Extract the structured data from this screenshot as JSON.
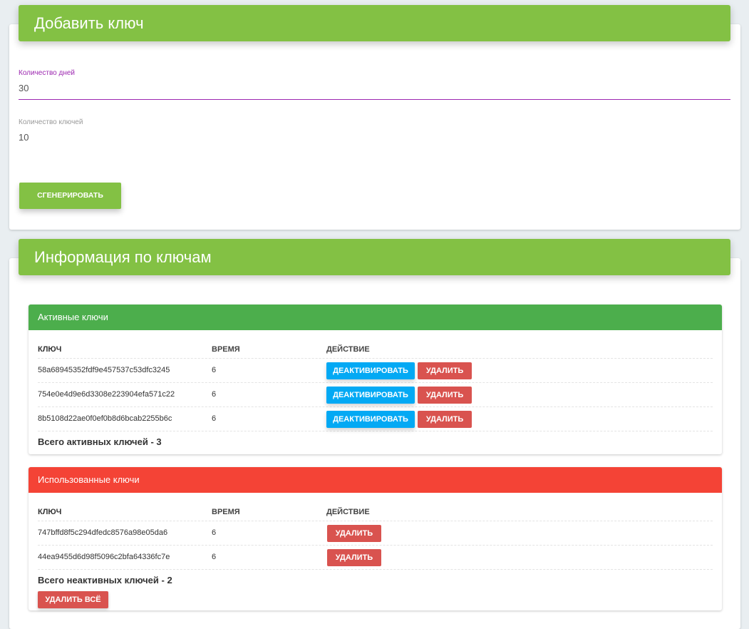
{
  "add_key": {
    "title": "Добавить ключ",
    "days_label": "Количество дней",
    "days_value": "30",
    "keys_label": "Количество ключей",
    "keys_value": "10",
    "generate_button": "Сгенерировать"
  },
  "info": {
    "title": "Информация по ключам",
    "columns": {
      "key": "Ключ",
      "time": "Время",
      "action": "Действие"
    },
    "active": {
      "title": "Активные ключи",
      "rows": [
        {
          "key": "58a68945352fdf9e457537c53dfc3245",
          "time": "6",
          "deactivate": "Деактивировать",
          "delete": "Удалить"
        },
        {
          "key": "754e0e4d9e6d3308e223904efa571c22",
          "time": "6",
          "deactivate": "Деактивировать",
          "delete": "Удалить"
        },
        {
          "key": "8b5108d22ae0f0ef0b8d6bcab2255b6c",
          "time": "6",
          "deactivate": "Деактивировать",
          "delete": "Удалить"
        }
      ],
      "total": "Всего активных ключей - 3"
    },
    "used": {
      "title": "Использованные ключи",
      "rows": [
        {
          "key": "747bffd8f5c294dfedc8576a98e05da6",
          "time": "6",
          "delete": "Удалить"
        },
        {
          "key": "44ea9455d6d98f5096c2bfa64336fc7e",
          "time": "6",
          "delete": "Удалить"
        }
      ],
      "total": "Всего неактивных ключей - 2",
      "delete_all": "Удалить всё"
    }
  },
  "colors": {
    "header_green": "#83c144",
    "active_green": "#4cae4c",
    "used_red": "#f44336",
    "deactivate_blue": "#03a9f4",
    "delete_red": "#d9534f",
    "focus_purple": "#9c27b0"
  }
}
